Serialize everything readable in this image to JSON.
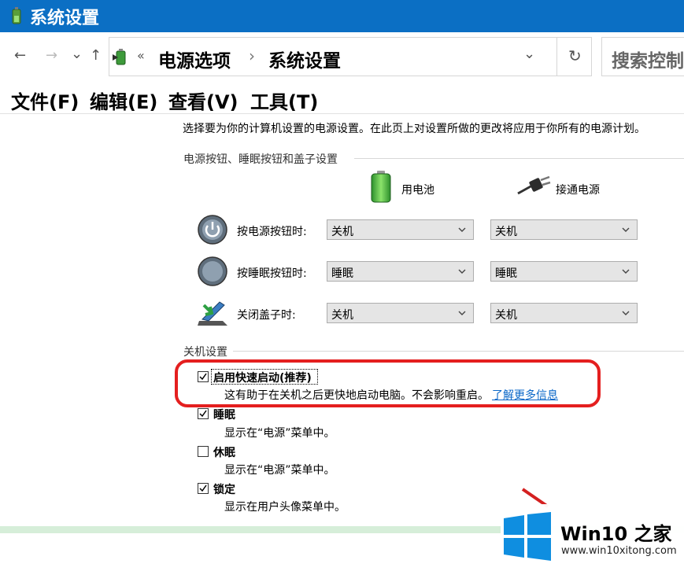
{
  "window": {
    "title": "系统设置"
  },
  "address_bar": {
    "back": "←",
    "forward": "→",
    "recent": "⌄",
    "up": "↑",
    "overflow": "«",
    "crumbs": [
      "电源选项",
      "系统设置"
    ],
    "separator": "›",
    "dropdown": "⌄",
    "refresh": "↻",
    "search_placeholder": "搜索控制"
  },
  "menu": [
    "文件(F)",
    "编辑(E)",
    "查看(V)",
    "工具(T)"
  ],
  "intro": "选择要为你的计算机设置的电源设置。在此页上对设置所做的更改将应用于你所有的电源计划。",
  "power_buttons": {
    "section_title": "电源按钮、睡眠按钮和盖子设置",
    "col_battery": "用电池",
    "col_plugged": "接通电源",
    "rows": [
      {
        "label": "按电源按钮时:",
        "battery": "关机",
        "plugged": "关机"
      },
      {
        "label": "按睡眠按钮时:",
        "battery": "睡眠",
        "plugged": "睡眠"
      },
      {
        "label": "关闭盖子时:",
        "battery": "关机",
        "plugged": "关机"
      }
    ]
  },
  "shutdown": {
    "section_title": "关机设置",
    "options": [
      {
        "label": "启用快速启动(推荐)",
        "desc": "这有助于在关机之后更快地启动电脑。不会影响重启。",
        "checked": true
      },
      {
        "label": "睡眠",
        "desc": "显示在“电源”菜单中。",
        "checked": true
      },
      {
        "label": "休眠",
        "desc": "显示在“电源”菜单中。",
        "checked": false
      },
      {
        "label": "锁定",
        "desc": "显示在用户头像菜单中。",
        "checked": true
      }
    ],
    "learn_more": "了解更多信息"
  },
  "watermark": {
    "title": "Win10 之家",
    "url": "www.win10xitong.com"
  },
  "colors": {
    "title_bar": "#0b6fc4",
    "link": "#0a67c8",
    "highlight": "#e41f1f"
  }
}
